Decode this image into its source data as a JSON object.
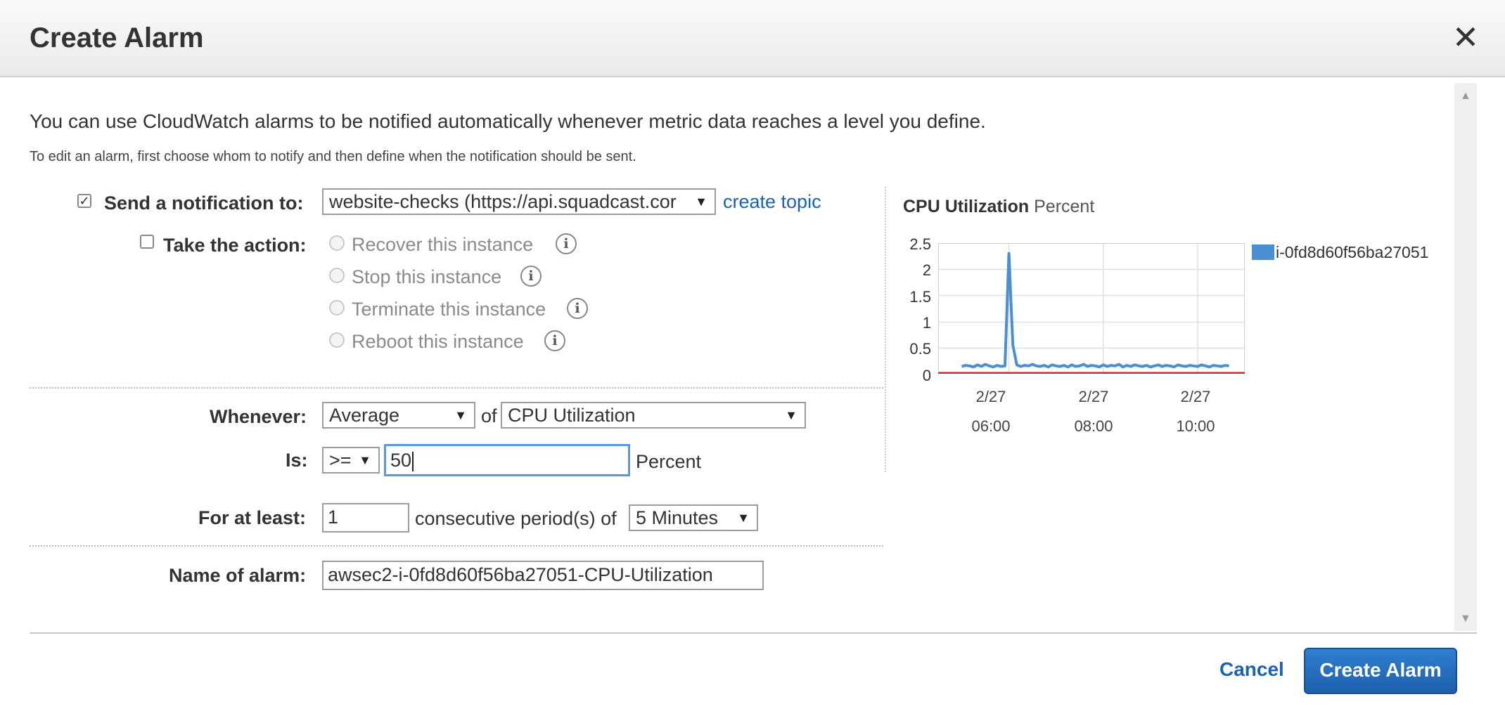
{
  "dialog": {
    "title": "Create Alarm",
    "close_glyph": "✕",
    "intro": "You can use CloudWatch alarms to be notified automatically whenever metric data reaches a level you define.",
    "subtitle": "To edit an alarm, first choose whom to notify and then define when the notification should be sent."
  },
  "notification": {
    "checked": true,
    "label": "Send a notification to:",
    "topic": "website-checks (https://api.squadcast.cor",
    "create_link": "create topic"
  },
  "action": {
    "checked": false,
    "label": "Take the action:",
    "options": [
      "Recover this instance",
      "Stop this instance",
      "Terminate this instance",
      "Reboot this instance"
    ],
    "info_glyph": "i"
  },
  "condition": {
    "whenever_label": "Whenever:",
    "statistic": "Average",
    "of_label": "of",
    "metric": "CPU Utilization",
    "is_label": "Is:",
    "operator": ">=",
    "threshold": "50",
    "unit": "Percent",
    "for_label": "For at least:",
    "periods": "1",
    "periods_text": "consecutive period(s) of",
    "period": "5 Minutes"
  },
  "name": {
    "label": "Name of alarm:",
    "value": "awsec2-i-0fd8d60f56ba27051-CPU-Utilization"
  },
  "footer": {
    "cancel": "Cancel",
    "create": "Create Alarm"
  },
  "colors": {
    "series": "#4a8fd0",
    "threshold": "#d62728",
    "primary_button": "#1f6fc5",
    "link": "#1a63b4"
  },
  "chart_data": {
    "type": "line",
    "title": "CPU Utilization",
    "unit": "Percent",
    "ylim": [
      0,
      2.5
    ],
    "yticks": [
      "2.5",
      "2",
      "1.5",
      "1",
      "0.5",
      "0"
    ],
    "xticks": [
      {
        "date": "2/27",
        "time": "06:00"
      },
      {
        "date": "2/27",
        "time": "08:00"
      },
      {
        "date": "2/27",
        "time": "10:00"
      }
    ],
    "grid": true,
    "legend": "right",
    "threshold": 0,
    "series": [
      {
        "name": "i-0fd8d60f56ba27051",
        "x": [
          "05:00",
          "05:05",
          "05:10",
          "05:15",
          "05:20",
          "05:25",
          "05:30",
          "05:35",
          "05:40",
          "05:45",
          "05:50",
          "05:55",
          "06:00",
          "06:05",
          "06:10",
          "06:15",
          "06:20",
          "06:25",
          "06:30",
          "06:35",
          "06:40",
          "06:45",
          "06:50",
          "06:55",
          "07:00",
          "07:05",
          "07:10",
          "07:15",
          "07:20",
          "07:25",
          "07:30",
          "07:35",
          "07:40",
          "07:45",
          "07:50",
          "07:55",
          "08:00",
          "08:05",
          "08:10",
          "08:15",
          "08:20",
          "08:25",
          "08:30",
          "08:35",
          "08:40",
          "08:45",
          "08:50",
          "08:55",
          "09:00",
          "09:05",
          "09:10",
          "09:15",
          "09:20",
          "09:25",
          "09:30",
          "09:35",
          "09:40",
          "09:45",
          "09:50",
          "09:55",
          "10:00",
          "10:05",
          "10:10",
          "10:15",
          "10:20",
          "10:25",
          "10:30",
          "10:35",
          "10:40"
        ],
        "values": [
          0.14,
          0.16,
          0.15,
          0.13,
          0.17,
          0.14,
          0.18,
          0.15,
          0.13,
          0.16,
          0.14,
          0.15,
          2.3,
          0.55,
          0.17,
          0.14,
          0.16,
          0.15,
          0.18,
          0.15,
          0.14,
          0.16,
          0.13,
          0.17,
          0.15,
          0.14,
          0.16,
          0.13,
          0.17,
          0.14,
          0.15,
          0.18,
          0.14,
          0.16,
          0.15,
          0.13,
          0.17,
          0.14,
          0.16,
          0.15,
          0.18,
          0.13,
          0.16,
          0.14,
          0.17,
          0.15,
          0.14,
          0.16,
          0.13,
          0.15,
          0.17,
          0.14,
          0.16,
          0.15,
          0.13,
          0.17,
          0.15,
          0.14,
          0.16,
          0.15,
          0.14,
          0.17,
          0.15,
          0.13,
          0.16,
          0.15,
          0.14,
          0.16,
          0.15
        ]
      }
    ]
  }
}
